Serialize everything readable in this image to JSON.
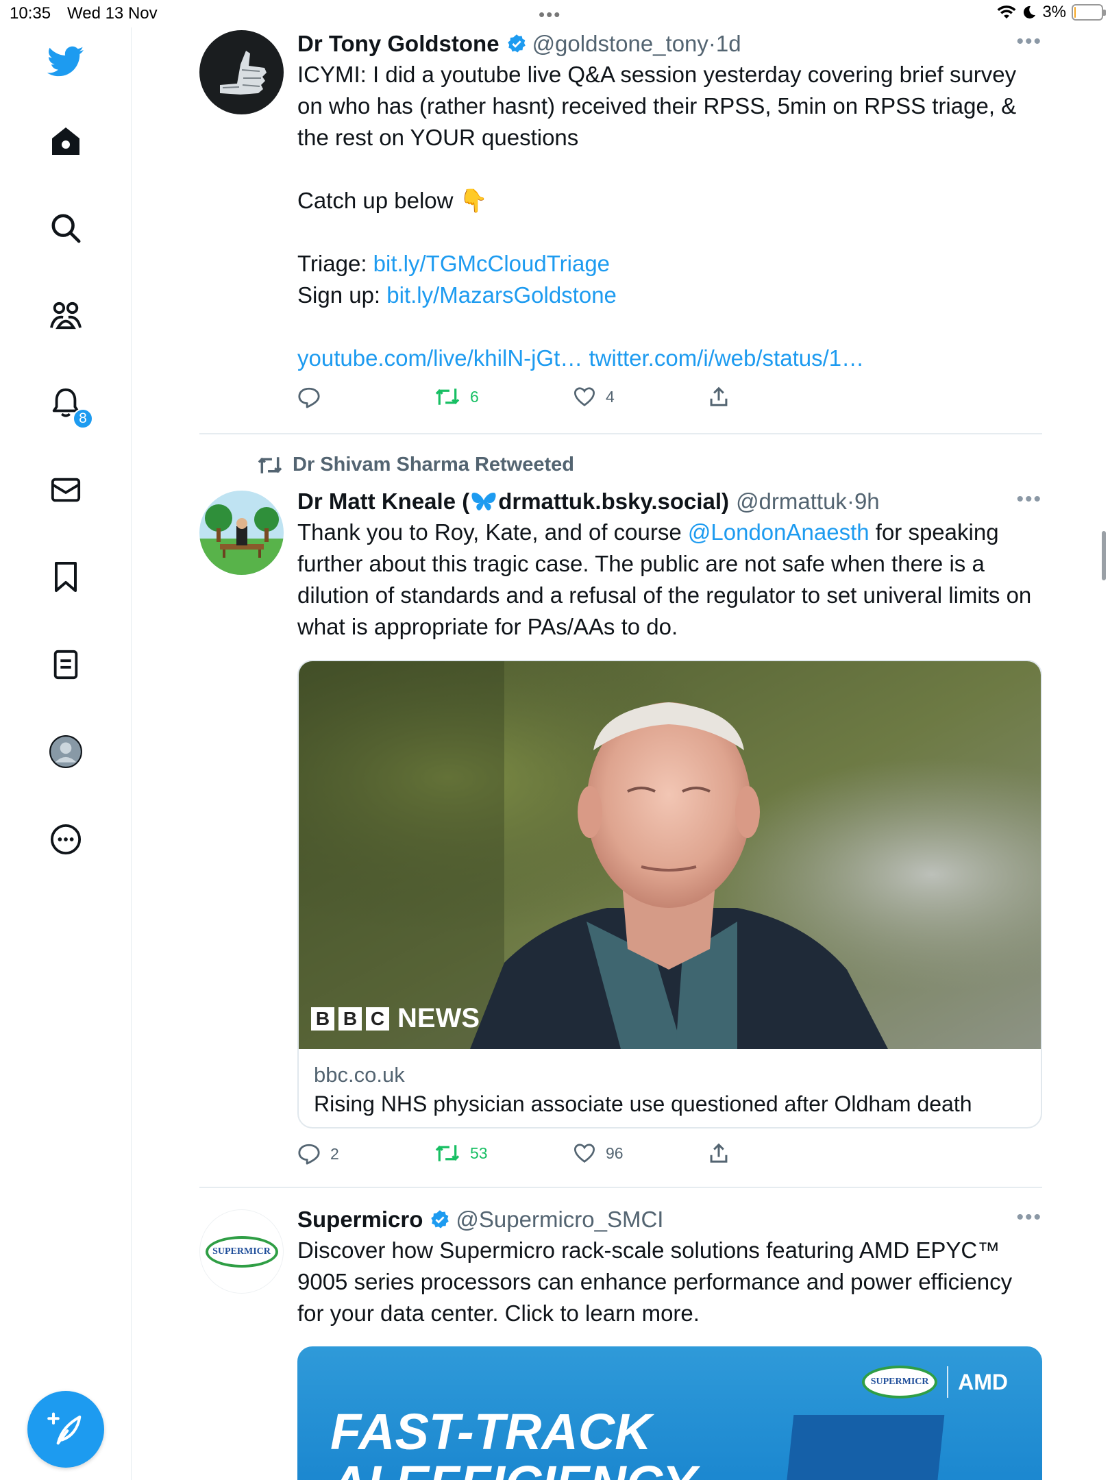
{
  "status_bar": {
    "time": "10:35",
    "date": "Wed 13 Nov",
    "grabber": "•••",
    "battery": "3%"
  },
  "sidebar": {
    "items": [
      {
        "name": "home",
        "icon": "home-icon"
      },
      {
        "name": "explore",
        "icon": "search-icon"
      },
      {
        "name": "communities",
        "icon": "communities-icon"
      },
      {
        "name": "notifications",
        "icon": "bell-icon",
        "badge": "8"
      },
      {
        "name": "messages",
        "icon": "mail-icon"
      },
      {
        "name": "bookmarks",
        "icon": "bookmark-icon"
      },
      {
        "name": "lists",
        "icon": "list-icon"
      },
      {
        "name": "profile",
        "icon": "avatar-icon"
      },
      {
        "name": "more",
        "icon": "more-circle-icon"
      }
    ],
    "compose_icon": "compose-icon"
  },
  "tweets": [
    {
      "name": "Dr Tony Goldstone",
      "handle": "@goldstone_tony",
      "sep": " · ",
      "time": "1d",
      "text_main": "ICYMI: I did a youtube live Q&A session yesterday covering brief survey on who has (rather hasnt) received their RPSS, 5min on RPSS triage, & the rest on YOUR questions",
      "catch_up": "Catch up below 👇",
      "triage_label": "Triage: ",
      "triage_link": "bit.ly/TGMcCloudTriage",
      "signup_label": "Sign up: ",
      "signup_link": "bit.ly/MazarsGoldstone",
      "link_youtube": "youtube.com/live/khilN-jGt…",
      "link_twitter": "twitter.com/i/web/status/1…",
      "retweets": "6",
      "likes": "4"
    },
    {
      "retweeted_by": "Dr Shivam Sharma Retweeted",
      "name_pre": "Dr Matt Kneale (",
      "name_post": "drmattuk.bsky.social)",
      "handle": "@drmattuk",
      "sep": " · ",
      "time": "9h",
      "text_a": "Thank you to Roy, Kate, and of course ",
      "mention": "@LondonAnaesth",
      "text_b": " for speaking further about this tragic case. The public are not safe when there is a dilution of standards and a refusal of the regulator to set univeral limits on what is appropriate for PAs/AAs to do.",
      "card": {
        "brand_letters": [
          "B",
          "B",
          "C"
        ],
        "brand_word": "NEWS",
        "domain": "bbc.co.uk",
        "title": "Rising NHS physician associate use questioned after Oldham death"
      },
      "replies": "2",
      "retweets": "53",
      "likes": "96"
    },
    {
      "name": "Supermicro",
      "handle": "@Supermicro_SMCI",
      "text": "Discover how Supermicro rack-scale solutions featuring AMD EPYC™ 9005 series processors can enhance performance and power efficiency for your data center. Click to learn more.",
      "avatar_logo": "SUPERMICR",
      "ad": {
        "logo_supermicro": "SUPERMICR",
        "logo_amd": "AMD",
        "headline_1": "FAST-TRACK",
        "headline_2": "AI EFFICIENCY"
      }
    }
  ],
  "colors": {
    "accent": "#1d9bf0",
    "retweet": "#17bf63",
    "muted": "#536471"
  }
}
